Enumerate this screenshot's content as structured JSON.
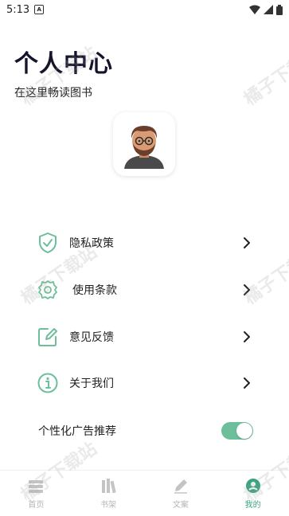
{
  "status_bar": {
    "time": "5:13"
  },
  "header": {
    "title": "个人中心",
    "subtitle": "在这里畅读图书"
  },
  "menu": [
    {
      "label": "隐私政策",
      "icon": "shield-check-icon"
    },
    {
      "label": "使用条款",
      "icon": "gear-icon"
    },
    {
      "label": "意见反馈",
      "icon": "edit-icon"
    },
    {
      "label": "关于我们",
      "icon": "info-icon"
    }
  ],
  "ad_toggle": {
    "label": "个性化广告推荐",
    "on": true
  },
  "bottom_nav": [
    {
      "label": "首页",
      "active": false
    },
    {
      "label": "书架",
      "active": false
    },
    {
      "label": "文案",
      "active": false
    },
    {
      "label": "我的",
      "active": true
    }
  ],
  "watermark": "橘子下载站",
  "colors": {
    "accent": "#3aa57f",
    "toggle_on": "#6cbf9a"
  }
}
